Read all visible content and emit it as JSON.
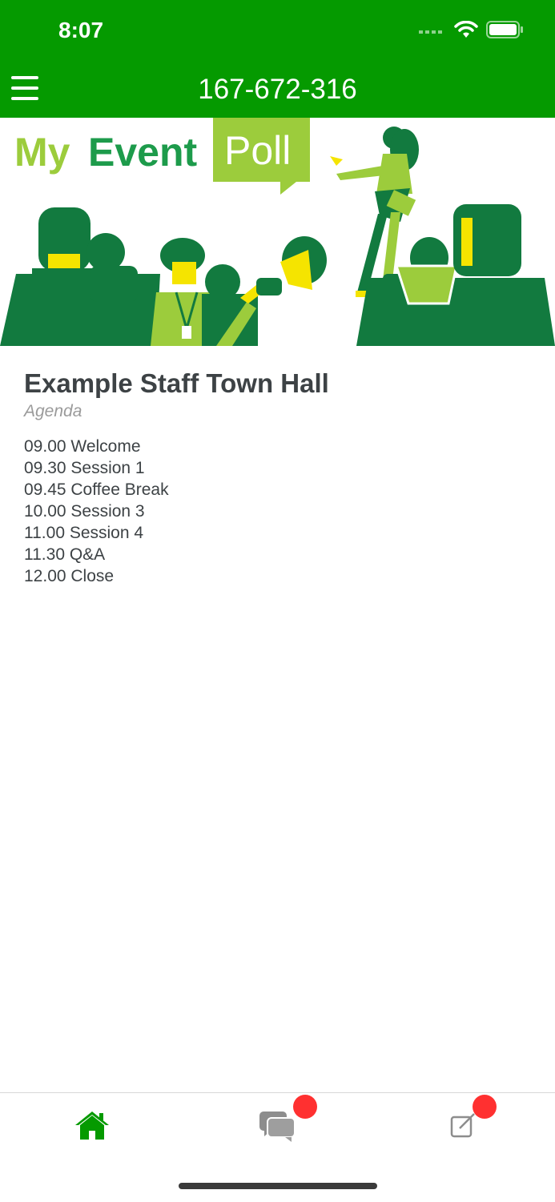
{
  "status_bar": {
    "time": "8:07"
  },
  "header": {
    "title": "167-672-316",
    "menu_icon": "hamburger-menu-icon"
  },
  "banner": {
    "logo_part1": "My",
    "logo_part2": "Event",
    "logo_part3": "Poll"
  },
  "event": {
    "title": "Example Staff Town Hall",
    "subtitle": "Agenda",
    "agenda": [
      "09.00 Welcome",
      "09.30 Session 1",
      "09.45 Coffee Break",
      "10.00 Session 3",
      "11.00 Session 4",
      "11.30 Q&A",
      "12.00 Close"
    ]
  },
  "tabbar": {
    "tabs": [
      {
        "icon": "home-icon",
        "active": true
      },
      {
        "icon": "chat-bubbles-icon",
        "badge": true
      },
      {
        "icon": "compose-icon",
        "badge": true
      }
    ]
  },
  "colors": {
    "brand_green": "#059a00",
    "dark_green": "#127a3f",
    "light_green": "#9ccc3c",
    "yellow": "#f5e400",
    "badge_red": "#ff3030"
  }
}
